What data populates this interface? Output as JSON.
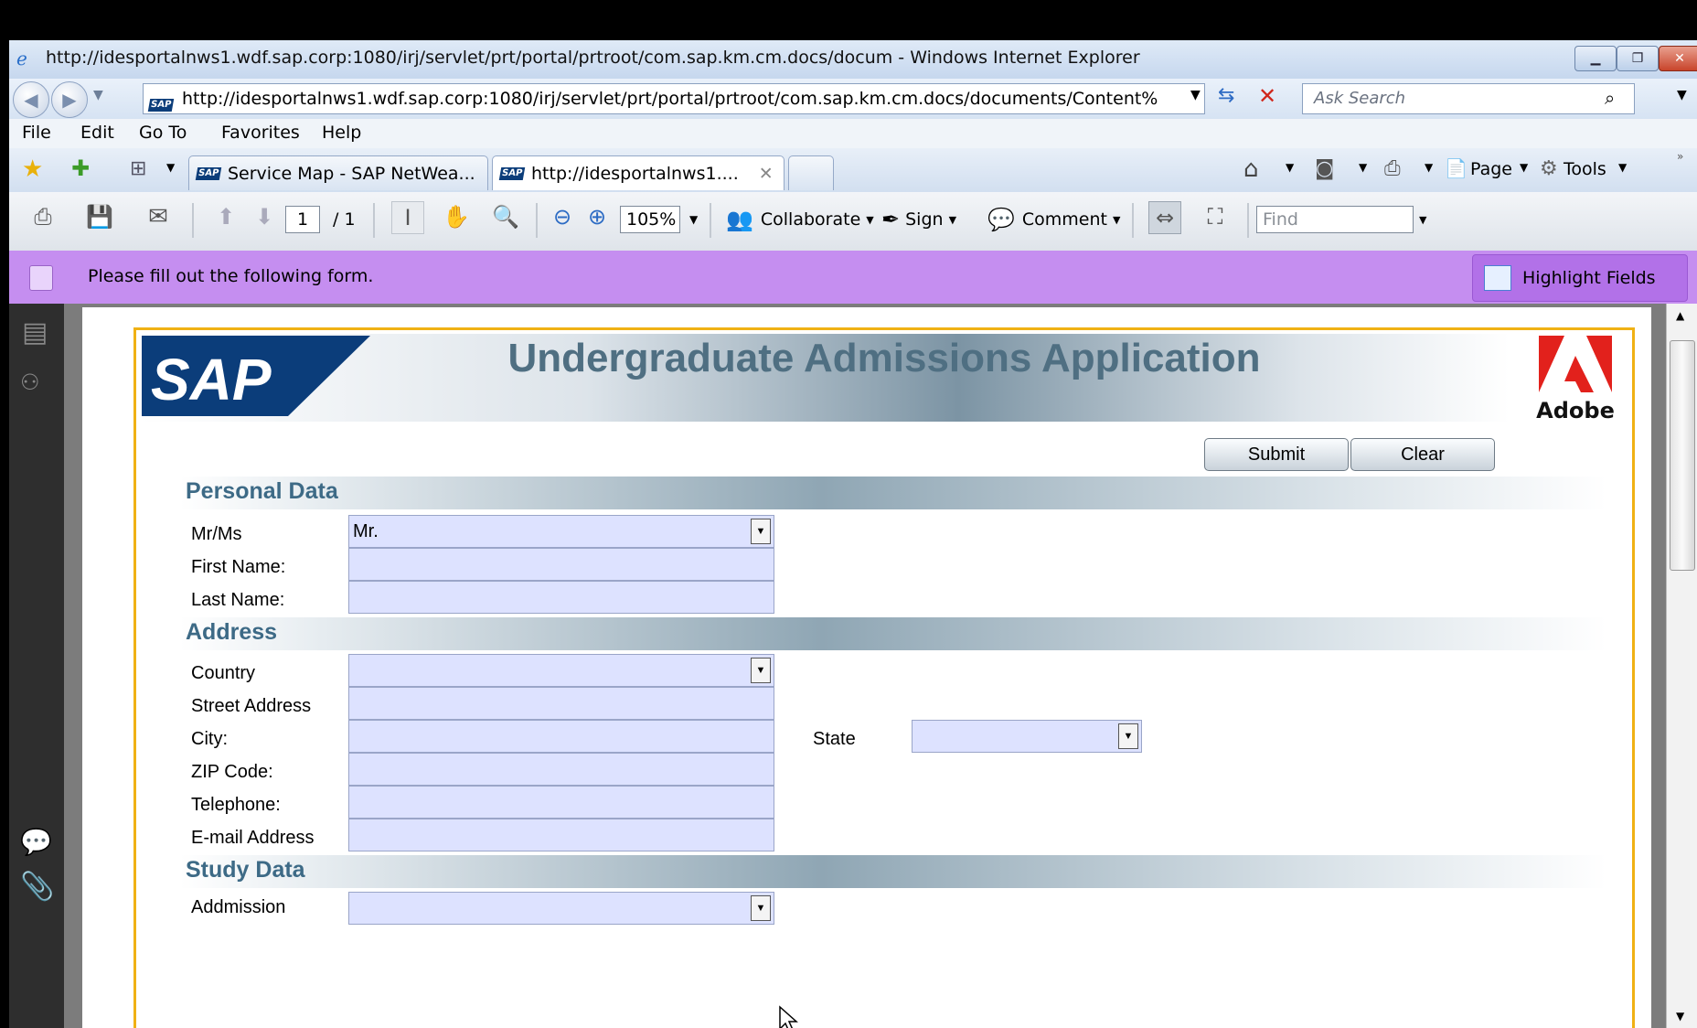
{
  "window": {
    "title": "http://idesportalnws1.wdf.sap.corp:1080/irj/servlet/prt/portal/prtroot/com.sap.km.cm.docs/docum - Windows Internet Explorer"
  },
  "address_bar": {
    "url": "http://idesportalnws1.wdf.sap.corp:1080/irj/servlet/prt/portal/prtroot/com.sap.km.cm.docs/documents/Content%",
    "search_placeholder": "Ask Search"
  },
  "menu": [
    "File",
    "Edit",
    "Go To",
    "Favorites",
    "Help"
  ],
  "tabs": [
    {
      "label": "Service Map - SAP NetWea..."
    },
    {
      "label": "http://idesportalnws1...."
    }
  ],
  "command_bar": {
    "page_label": "Page",
    "tools_label": "Tools"
  },
  "reader_toolbar": {
    "page_current": "1",
    "page_total": "/ 1",
    "zoom": "105%",
    "collaborate": "Collaborate",
    "sign": "Sign",
    "comment": "Comment",
    "find_placeholder": "Find"
  },
  "form_bar": {
    "message": "Please fill out the following form.",
    "highlight_label": "Highlight Fields"
  },
  "form": {
    "title": "Undergraduate Admissions Application",
    "sap_logo_text": "SAP",
    "adobe_logo_text": "Adobe",
    "submit_label": "Submit",
    "clear_label": "Clear",
    "sections": {
      "personal": "Personal Data",
      "address": "Address",
      "study": "Study Data"
    },
    "fields": {
      "mr_ms": {
        "label": "Mr/Ms",
        "value": "Mr."
      },
      "first_name": {
        "label": "First Name:",
        "value": ""
      },
      "last_name": {
        "label": "Last Name:",
        "value": ""
      },
      "country": {
        "label": "Country",
        "value": ""
      },
      "street": {
        "label": "Street Address",
        "value": ""
      },
      "city": {
        "label": "City:",
        "value": ""
      },
      "state": {
        "label": "State",
        "value": ""
      },
      "zip": {
        "label": "ZIP Code:",
        "value": ""
      },
      "telephone": {
        "label": "Telephone:",
        "value": ""
      },
      "email": {
        "label": "E-mail Address",
        "value": ""
      },
      "admission": {
        "label": "Addmission",
        "value": ""
      }
    }
  },
  "colors": {
    "form_bar": "#c58ef0",
    "field_fill": "#dde2ff",
    "form_border": "#f0b114",
    "section_text": "#3d6a86"
  }
}
